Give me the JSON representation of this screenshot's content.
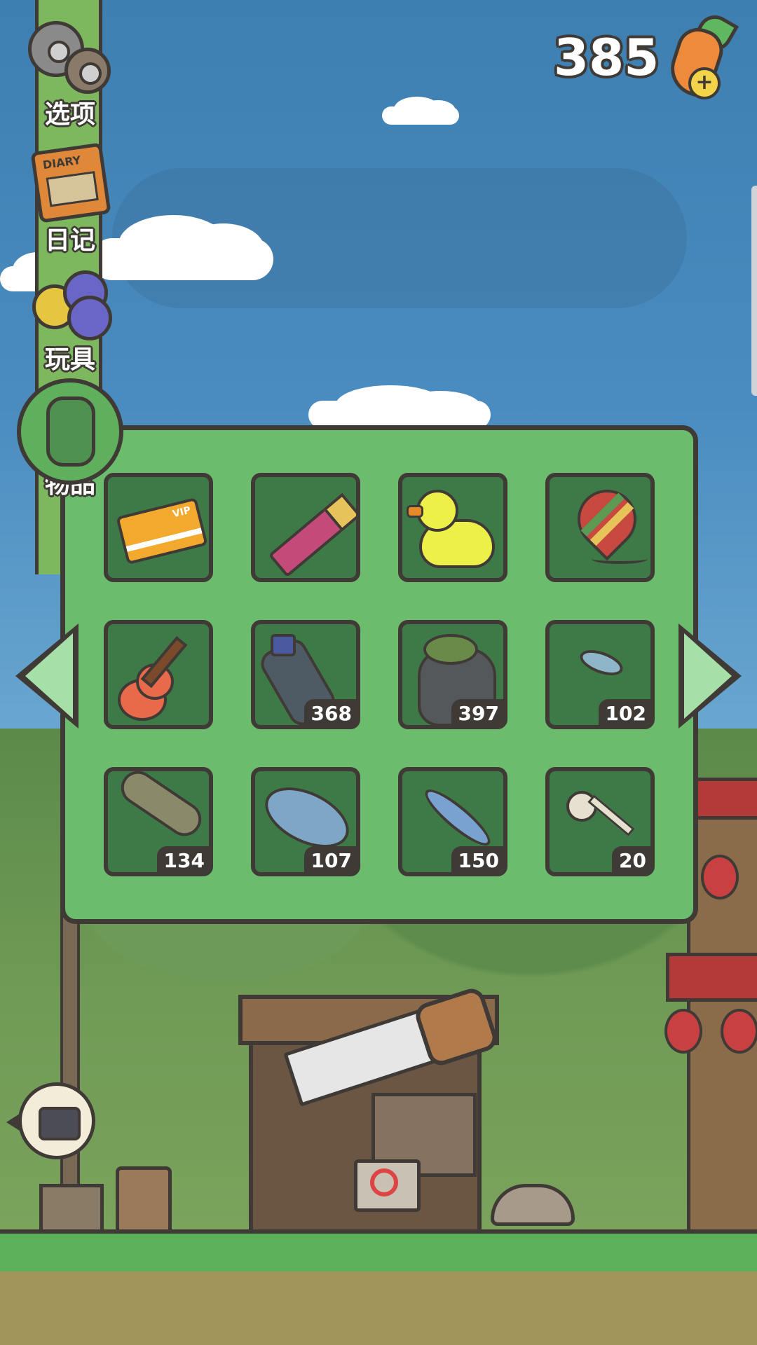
{
  "menu": {
    "items": [
      {
        "label": "选项",
        "icon": "gear-icon"
      },
      {
        "label": "日记",
        "icon": "diary-icon"
      },
      {
        "label": "玩具",
        "icon": "toy-ball-icon"
      },
      {
        "label": "物品",
        "icon": "backpack-icon"
      }
    ]
  },
  "currency": {
    "amount": "385",
    "icon": "carrot-icon",
    "add_icon": "plus-icon"
  },
  "inventory": {
    "slots": [
      {
        "item": "vip-card-icon",
        "count": ""
      },
      {
        "item": "crayon-icon",
        "count": ""
      },
      {
        "item": "rubber-duck-icon",
        "count": ""
      },
      {
        "item": "spinning-top-icon",
        "count": ""
      },
      {
        "item": "ukulele-icon",
        "count": ""
      },
      {
        "item": "plastic-bottle-icon",
        "count": "368"
      },
      {
        "item": "trash-bag-icon",
        "count": "397"
      },
      {
        "item": "small-fish-icon",
        "count": "102"
      },
      {
        "item": "catfish-icon",
        "count": "134"
      },
      {
        "item": "salmon-icon",
        "count": "107"
      },
      {
        "item": "mackerel-icon",
        "count": "150"
      },
      {
        "item": "fish-bone-icon",
        "count": "20"
      }
    ]
  },
  "colors": {
    "panel": "#6cbc6e",
    "slot": "#3e7a47",
    "outline": "#3f3a35",
    "arrow": "#a6e0a8"
  }
}
